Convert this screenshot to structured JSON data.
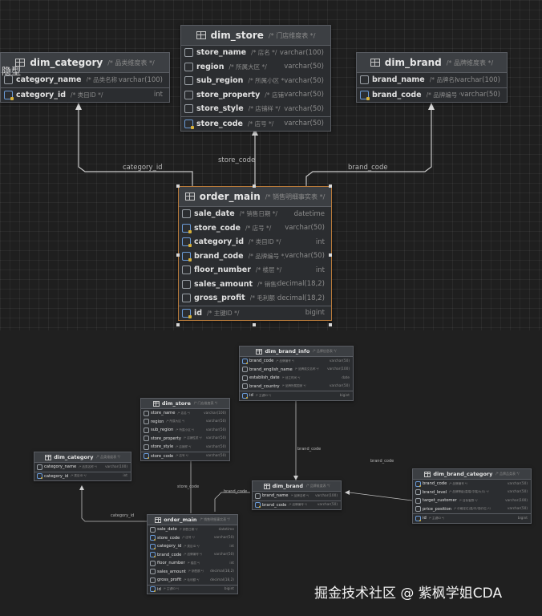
{
  "overlay_text": "隐型",
  "watermark": "掘金技术社区 @ 紫枫学姐CDA",
  "top": {
    "tables": {
      "dim_category": {
        "name": "dim_category",
        "comment": "/* 品类维度表 */",
        "fields": [
          {
            "name": "category_name",
            "comment": "/* 品类名称 */",
            "type": "varchar(100)",
            "key": false
          },
          {
            "name": "category_id",
            "comment": "/* 类目ID */",
            "type": "int",
            "key": true
          }
        ]
      },
      "dim_store": {
        "name": "dim_store",
        "comment": "/* 门店维度表 */",
        "fields": [
          {
            "name": "store_name",
            "comment": "/* 店名 */",
            "type": "varchar(100)",
            "key": false
          },
          {
            "name": "region",
            "comment": "/* 所属大区 */",
            "type": "varchar(50)",
            "key": false
          },
          {
            "name": "sub_region",
            "comment": "/* 所属小区 */",
            "type": "varchar(50)",
            "key": false
          },
          {
            "name": "store_property",
            "comment": "/* 店铺性质 */",
            "type": "varchar(50)",
            "key": false
          },
          {
            "name": "store_style",
            "comment": "/* 店铺样 */",
            "type": "varchar(50)",
            "key": false
          },
          {
            "name": "store_code",
            "comment": "/* 店号 */",
            "type": "varchar(50)",
            "key": true
          }
        ]
      },
      "dim_brand": {
        "name": "dim_brand",
        "comment": "/* 品牌维度表 */",
        "fields": [
          {
            "name": "brand_name",
            "comment": "/* 品牌名称 */",
            "type": "varchar(100)",
            "key": false
          },
          {
            "name": "brand_code",
            "comment": "/* 品牌编号 */",
            "type": "varchar(50)",
            "key": true
          }
        ]
      },
      "order_main": {
        "name": "order_main",
        "comment": "/* 销售明细事实表 */",
        "fields": [
          {
            "name": "sale_date",
            "comment": "/* 销售日期 */",
            "type": "datetime",
            "key": false
          },
          {
            "name": "store_code",
            "comment": "/* 店号 */",
            "type": "varchar(50)",
            "key": true
          },
          {
            "name": "category_id",
            "comment": "/* 类目ID */",
            "type": "int",
            "key": true
          },
          {
            "name": "brand_code",
            "comment": "/* 品牌编号 */",
            "type": "varchar(50)",
            "key": true
          },
          {
            "name": "floor_number",
            "comment": "/* 楼层 */",
            "type": "int",
            "key": false
          },
          {
            "name": "sales_amount",
            "comment": "/* 销售额 */",
            "type": "decimal(18,2)",
            "key": false
          },
          {
            "name": "gross_profit",
            "comment": "/* 毛利额 */",
            "type": "decimal(18,2)",
            "key": false
          },
          {
            "name": "id",
            "comment": "/* 主键ID */",
            "type": "bigint",
            "key": true
          }
        ]
      }
    },
    "links": {
      "category": "category_id",
      "store": "store_code",
      "brand": "brand_code"
    }
  },
  "bottom": {
    "tables": {
      "dim_brand_info": {
        "name": "dim_brand_info",
        "comment": "/* 品牌信息表 */",
        "fields": [
          {
            "name": "brand_code",
            "comment": "/* 品牌编号 */",
            "type": "varchar(50)",
            "key": true
          },
          {
            "name": "brand_english_name",
            "comment": "/* 品牌英文名称 */",
            "type": "varchar(100)",
            "key": false
          },
          {
            "name": "establish_date",
            "comment": "/* 创立时间 */",
            "type": "date",
            "key": false
          },
          {
            "name": "brand_country",
            "comment": "/* 品牌所属国家 */",
            "type": "varchar(50)",
            "key": false
          },
          {
            "name": "id",
            "comment": "/* 主键ID */",
            "type": "bigint",
            "key": true
          }
        ]
      },
      "dim_store": {
        "name": "dim_store",
        "comment": "/* 门店维度表 */",
        "fields": [
          {
            "name": "store_name",
            "comment": "/* 店名 */",
            "type": "varchar(100)",
            "key": false
          },
          {
            "name": "region",
            "comment": "/* 所属大区 */",
            "type": "varchar(50)",
            "key": false
          },
          {
            "name": "sub_region",
            "comment": "/* 所属小区 */",
            "type": "varchar(50)",
            "key": false
          },
          {
            "name": "store_property",
            "comment": "/* 店铺性质 */",
            "type": "varchar(50)",
            "key": false
          },
          {
            "name": "store_style",
            "comment": "/* 店铺样 */",
            "type": "varchar(50)",
            "key": false
          },
          {
            "name": "store_code",
            "comment": "/* 店号 */",
            "type": "varchar(50)",
            "key": true
          }
        ]
      },
      "dim_category": {
        "name": "dim_category",
        "comment": "/* 品类维度表 */",
        "fields": [
          {
            "name": "category_name",
            "comment": "/* 品类名称 */",
            "type": "varchar(100)",
            "key": false
          },
          {
            "name": "category_id",
            "comment": "/* 类目ID */",
            "type": "int",
            "key": true
          }
        ]
      },
      "dim_brand": {
        "name": "dim_brand",
        "comment": "/* 品牌维度表 */",
        "fields": [
          {
            "name": "brand_name",
            "comment": "/* 品牌名称 */",
            "type": "varchar(100)",
            "key": false
          },
          {
            "name": "brand_code",
            "comment": "/* 品牌编号 */",
            "type": "varchar(50)",
            "key": true
          }
        ]
      },
      "dim_brand_category": {
        "name": "dim_brand_category",
        "comment": "/* 品牌品类表 */",
        "fields": [
          {
            "name": "brand_code",
            "comment": "/* 品牌编号 */",
            "type": "varchar(50)",
            "key": true
          },
          {
            "name": "brand_level",
            "comment": "/* 品牌等级(高端/中端/大众) */",
            "type": "varchar(50)",
            "key": false
          },
          {
            "name": "target_customer",
            "comment": "/* 目标客群 */",
            "type": "varchar(100)",
            "key": false
          },
          {
            "name": "price_position",
            "comment": "/* 价格定位(高/中/低价位) */",
            "type": "varchar(50)",
            "key": false
          },
          {
            "name": "id",
            "comment": "/* 主键ID */",
            "type": "bigint",
            "key": true
          }
        ]
      },
      "order_main": {
        "name": "order_main",
        "comment": "/* 销售明细事实表 */",
        "fields": [
          {
            "name": "sale_date",
            "comment": "/* 销售日期 */",
            "type": "datetime",
            "key": false
          },
          {
            "name": "store_code",
            "comment": "/* 店号 */",
            "type": "varchar(50)",
            "key": true
          },
          {
            "name": "category_id",
            "comment": "/* 类目ID */",
            "type": "int",
            "key": true
          },
          {
            "name": "brand_code",
            "comment": "/* 品牌编号 */",
            "type": "varchar(50)",
            "key": true
          },
          {
            "name": "floor_number",
            "comment": "/* 楼层 */",
            "type": "int",
            "key": false
          },
          {
            "name": "sales_amount",
            "comment": "/* 销售额 */",
            "type": "decimal(18,2)",
            "key": false
          },
          {
            "name": "gross_profit",
            "comment": "/* 毛利额 */",
            "type": "decimal(18,2)",
            "key": false
          },
          {
            "name": "id",
            "comment": "/* 主键ID */",
            "type": "bigint",
            "key": true
          }
        ]
      }
    },
    "links": {
      "info": "brand_code",
      "store": "store_code",
      "category": "category_id",
      "brand": "brand_code",
      "brand_category": "brand_code"
    }
  }
}
